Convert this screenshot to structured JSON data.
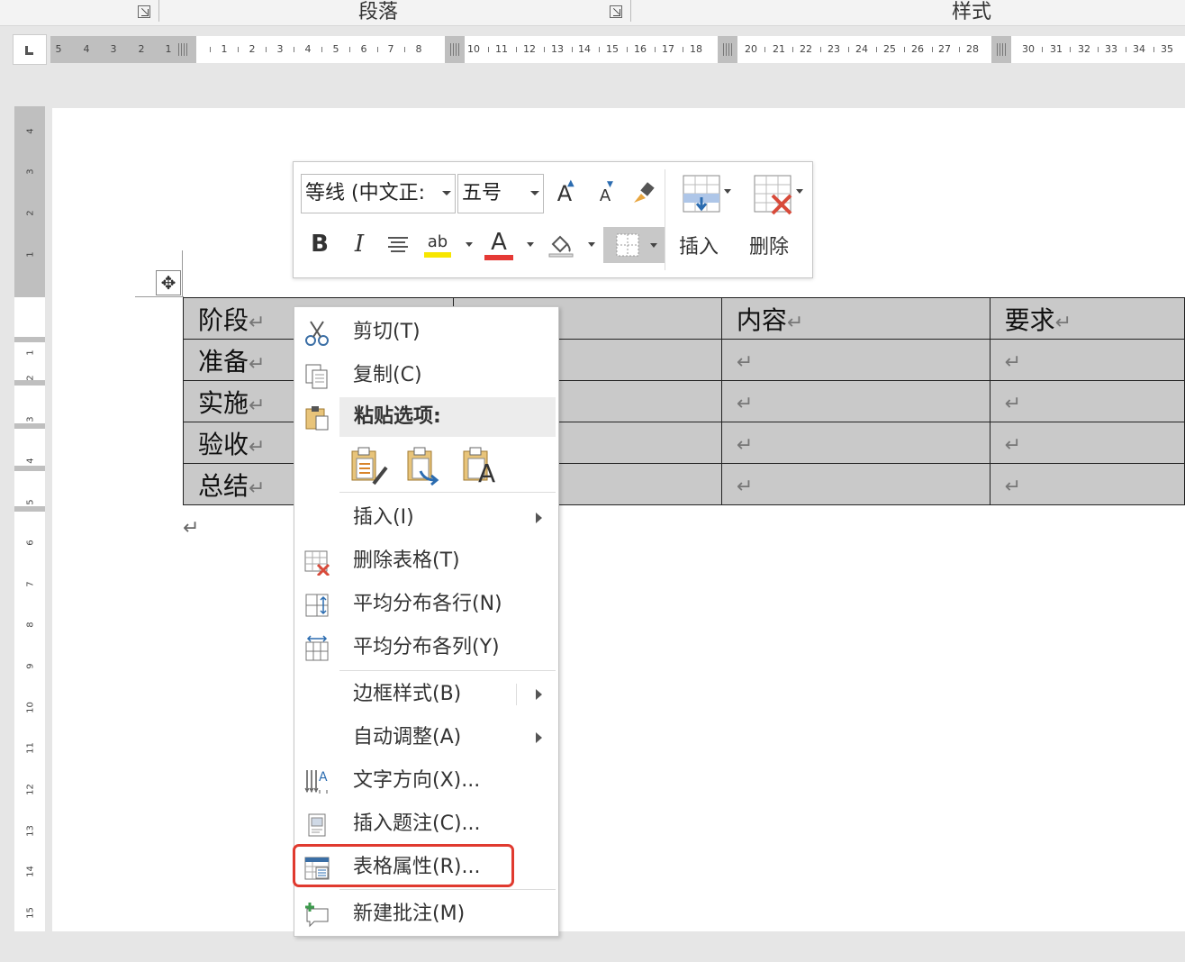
{
  "ribbon": {
    "groups": [
      {
        "label": ""
      },
      {
        "label": "段落"
      },
      {
        "label": "样式"
      }
    ]
  },
  "ruler": {
    "left_numbers": [
      "5",
      "4",
      "3",
      "2",
      "1"
    ],
    "numbers": [
      "1",
      "2",
      "3",
      "4",
      "5",
      "6",
      "7",
      "8",
      "10",
      "11",
      "12",
      "13",
      "14",
      "15",
      "16",
      "17",
      "18",
      "20",
      "21",
      "22",
      "23",
      "24",
      "25",
      "26",
      "27",
      "28",
      "30",
      "31",
      "32",
      "33",
      "34",
      "35"
    ],
    "vertical_numbers": [
      "4",
      "3",
      "2",
      "1",
      "1",
      "2",
      "3",
      "4",
      "5",
      "6",
      "7",
      "8",
      "9",
      "10",
      "11",
      "12",
      "13",
      "14",
      "15"
    ]
  },
  "mini_toolbar": {
    "font_name": "等线 (中文正:",
    "font_size": "五号",
    "grow_font_glyph": "A",
    "shrink_font_glyph": "A",
    "bold_glyph": "B",
    "italic_glyph": "I",
    "highlight_glyph": "ab",
    "font_color_glyph": "A",
    "highlight_color": "#f7e600",
    "font_color": "#e53935",
    "insert_label": "插入",
    "delete_label": "删除"
  },
  "table": {
    "rows": [
      [
        "阶段",
        "",
        "内容",
        "要求"
      ],
      [
        "准备",
        "",
        "",
        ""
      ],
      [
        "实施",
        "",
        "",
        ""
      ],
      [
        "验收",
        "",
        "",
        ""
      ],
      [
        "总结",
        "",
        "",
        ""
      ]
    ],
    "paragraph_mark": "↵"
  },
  "context_menu": {
    "items": [
      {
        "label": "剪切(T)",
        "icon": "scissors-icon"
      },
      {
        "label": "复制(C)",
        "icon": "copy-icon"
      },
      {
        "label": "粘贴选项:",
        "icon": "paste-icon"
      },
      {
        "label": "插入(I)",
        "icon": ""
      },
      {
        "label": "删除表格(T)",
        "icon": "delete-table-icon"
      },
      {
        "label": "平均分布各行(N)",
        "icon": "distribute-rows-icon"
      },
      {
        "label": "平均分布各列(Y)",
        "icon": "distribute-columns-icon"
      },
      {
        "label": "边框样式(B)",
        "icon": ""
      },
      {
        "label": "自动调整(A)",
        "icon": ""
      },
      {
        "label": "文字方向(X)...",
        "icon": "text-direction-icon"
      },
      {
        "label": "插入题注(C)...",
        "icon": "insert-caption-icon"
      },
      {
        "label": "表格属性(R)...",
        "icon": "table-properties-icon"
      },
      {
        "label": "新建批注(M)",
        "icon": "new-comment-icon"
      }
    ],
    "paste_option_glyph": "A",
    "highlight_color": "#e03a2f"
  }
}
